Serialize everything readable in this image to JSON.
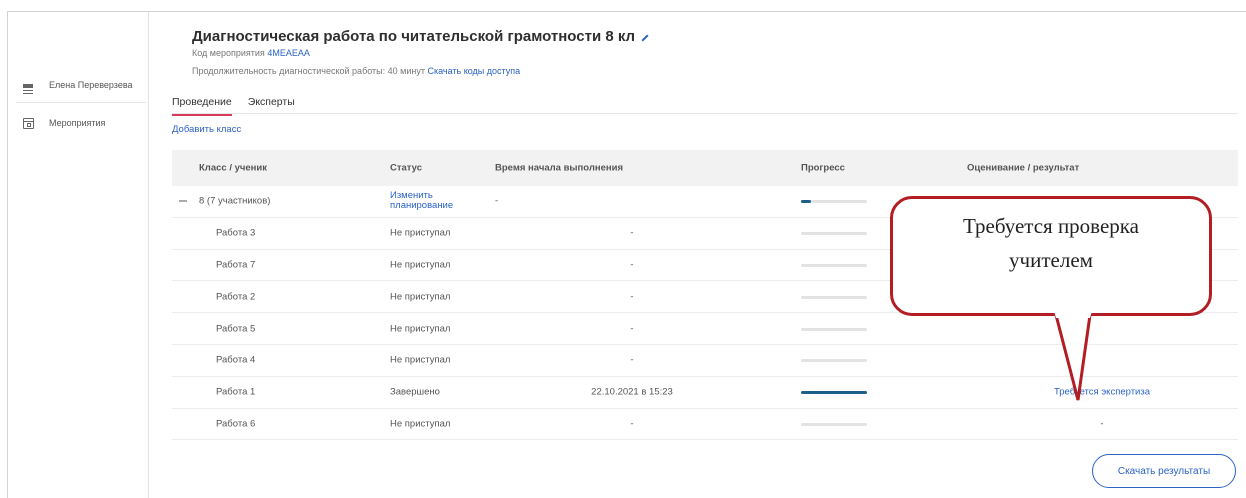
{
  "sidebar": {
    "user_name": "Елена Переверзева",
    "items": [
      {
        "label": "Мероприятия",
        "icon": "calendar-icon"
      }
    ]
  },
  "header": {
    "title": "Диагностическая работа по читательской грамотности 8 кл",
    "event_code_label": "Код мероприятия",
    "event_code": "4MEAEAA",
    "duration_text": "Продолжительность диагностической работы: 40 минут",
    "download_codes_link": "Скачать коды доступа"
  },
  "tabs": [
    {
      "label": "Проведение",
      "active": true
    },
    {
      "label": "Эксперты",
      "active": false
    }
  ],
  "add_class_link": "Добавить класс",
  "table": {
    "headers": [
      "Класс / ученик",
      "Статус",
      "Время начала выполнения",
      "Прогресс",
      "Оценивание / результат"
    ],
    "group": {
      "label": "8 (7 участников)",
      "status_link": "Изменить планирование",
      "status_line1": "Изменить",
      "status_line2": "планирование",
      "start_time": "-",
      "progress": 0.15
    },
    "rows": [
      {
        "name": "Работа 3",
        "status": "Не приступал",
        "start_time": "-",
        "progress": 0,
        "result": ""
      },
      {
        "name": "Работа 7",
        "status": "Не приступал",
        "start_time": "-",
        "progress": 0,
        "result": ""
      },
      {
        "name": "Работа 2",
        "status": "Не приступал",
        "start_time": "-",
        "progress": 0,
        "result": ""
      },
      {
        "name": "Работа 5",
        "status": "Не приступал",
        "start_time": "-",
        "progress": 0,
        "result": ""
      },
      {
        "name": "Работа 4",
        "status": "Не приступал",
        "start_time": "-",
        "progress": 0,
        "result": ""
      },
      {
        "name": "Работа 1",
        "status": "Завершено",
        "start_time": "22.10.2021 в 15:23",
        "progress": 1.0,
        "result": "Требуется экспертиза"
      },
      {
        "name": "Работа 6",
        "status": "Не приступал",
        "start_time": "-",
        "progress": 0,
        "result": "-"
      }
    ]
  },
  "download_results_button": "Скачать результаты",
  "callout": {
    "line1": "Требуется проверка",
    "line2": "учителем"
  },
  "colors": {
    "accent": "#2b63c6",
    "active_tab": "#d83b5c",
    "progress": "#1e5f8a",
    "callout_border": "#b21e24"
  }
}
